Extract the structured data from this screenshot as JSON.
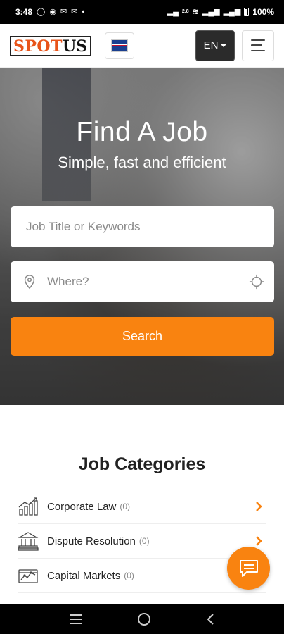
{
  "status_bar": {
    "time": "3:48",
    "battery_text": "100%",
    "net_speed": "2.8 KB/S"
  },
  "header": {
    "logo_part1": "SPOT",
    "logo_part2": "US",
    "lang_label": "EN"
  },
  "hero": {
    "title": "Find A Job",
    "subtitle": "Simple, fast and efficient",
    "keywords_placeholder": "Job Title or Keywords",
    "where_placeholder": "Where?",
    "search_label": "Search"
  },
  "categories": {
    "title": "Job Categories",
    "items": [
      {
        "label": "Corporate Law",
        "count": "(0)",
        "icon": "chart-growth-icon"
      },
      {
        "label": "Dispute Resolution",
        "count": "(0)",
        "icon": "courthouse-icon"
      },
      {
        "label": "Capital Markets",
        "count": "(0)",
        "icon": "market-chart-icon"
      }
    ]
  },
  "colors": {
    "accent": "#f98310",
    "logo_red": "#e8541a"
  }
}
